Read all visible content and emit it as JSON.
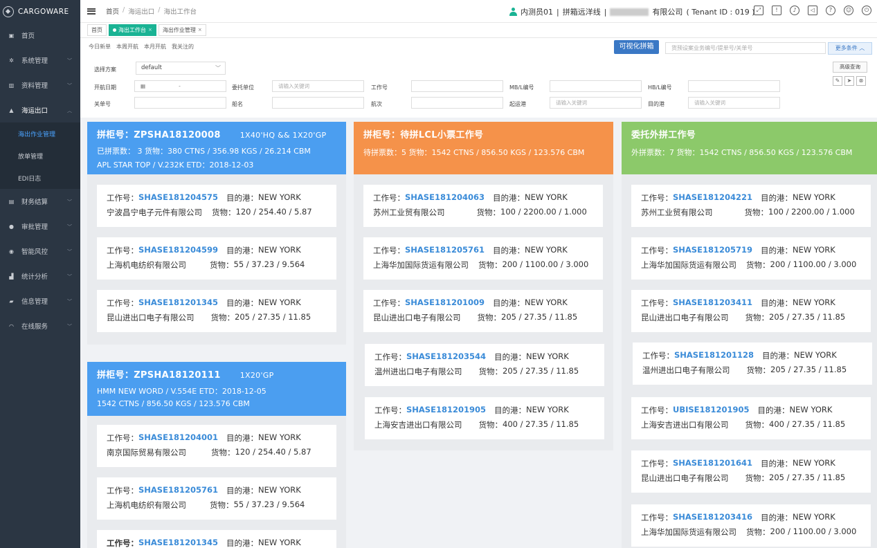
{
  "sidebar": {
    "brand": "CARGOWARE",
    "items": [
      {
        "label": "首页",
        "icon": "dashboard-icon"
      },
      {
        "label": "系统管理",
        "icon": "gear-icon"
      },
      {
        "label": "资料管理",
        "icon": "book-icon"
      },
      {
        "label": "海运出口",
        "icon": "ship-icon"
      },
      {
        "label": "财务结算",
        "icon": "wallet-icon"
      },
      {
        "label": "审批管理",
        "icon": "check-icon"
      },
      {
        "label": "智能风控",
        "icon": "shield-icon"
      },
      {
        "label": "统计分析",
        "icon": "bar-chart-icon"
      },
      {
        "label": "信息管理",
        "icon": "message-icon"
      },
      {
        "label": "在线服务",
        "icon": "wifi-icon"
      }
    ],
    "subitems": [
      "海出作业管理",
      "放单管理",
      "EDI日志"
    ]
  },
  "header": {
    "crumb_home": "首页",
    "crumb_mid": "海运出口",
    "crumb_current": "海出工作台",
    "user": "内测员01",
    "role": "拼箱远洋线",
    "company_suffix": "有限公司",
    "tenant": "( Tenant ID : 019 )"
  },
  "tabs": [
    {
      "label": "首页"
    },
    {
      "label": "海出工作台"
    },
    {
      "label": "海出作业管理"
    }
  ],
  "filters": {
    "quick": [
      "今日新单",
      "本周开航",
      "本月开航",
      "我关注的"
    ],
    "viz_button": "可视化拼箱",
    "search_placeholder": "货预设案业务编号/提单号/关单号",
    "more_button": "更多条件",
    "scheme_label": "选择方案",
    "scheme_value": "default",
    "advanced_button": "高级查询",
    "sail_date": "开航日期",
    "date_sep": "-",
    "consignor": "委托单位",
    "job_no": "工作号",
    "mbl": "MB/L编号",
    "hbl": "HB/L编号",
    "customs_no": "关单号",
    "vessel": "船名",
    "voyage": "航次",
    "pol": "起运港",
    "pod": "目的港",
    "keyword_placeholder": "请输入关键词"
  },
  "labels": {
    "job": "工作号：",
    "dest": "目的港：",
    "cargo": "货物："
  },
  "columns": [
    {
      "color": "#4b9ef0",
      "header": [
        {
          "title": "拼柜号：ZPSHA18120008",
          "container": "1X40'HQ && 1X20'GP",
          "line2": "已拼票数：  3      货物：380 CTNS / 356.98 KGS / 26.214 CBM",
          "line3": "APL STAR TOP / V.232K                    ETD：2018-12-03",
          "cards": [
            {
              "job": "SHASE181204575",
              "dest": "NEW YORK",
              "company": "宁波昌宁电子元件有限公司",
              "cargo": "120 / 254.40 / 5.87"
            },
            {
              "job": "SHASE181204599",
              "dest": "NEW YORK",
              "company": "上海机电纺织有限公司",
              "cargo": "55  / 37.23 / 9.564"
            },
            {
              "job": "SHASE181201345",
              "dest": "NEW YORK",
              "company": "昆山进出口电子有限公司",
              "cargo": "205  / 27.35 / 11.85"
            }
          ]
        },
        {
          "title": "拼柜号：ZPSHA18120111",
          "container": "1X20'GP",
          "line2": "HMM NEW WORD / V.554E           ETD：2018-12-05",
          "line3": "1542 CTNS / 856.50 KGS / 123.576 CBM",
          "cards": [
            {
              "job": "SHASE181204001",
              "dest": "NEW YORK",
              "company": "南京国际贸易有限公司",
              "cargo": "120 / 254.40 / 5.87"
            },
            {
              "job": "SHASE181205761",
              "dest": "NEW YORK",
              "company": "上海机电纺织有限公司",
              "cargo": "55  / 37.23 / 9.564"
            },
            {
              "job": "SHASE181201345",
              "dest": "NEW YORK",
              "company": "",
              "cargo": ""
            }
          ]
        }
      ]
    },
    {
      "color": "#f5924a",
      "header": [
        {
          "title": "拼柜号：待拼LCL小票工作号",
          "container": "",
          "line2": "待拼票数：5      货物：1542 CTNS / 856.50 KGS / 123.576 CBM",
          "line3": "",
          "cards": [
            {
              "job": "SHASE181204063",
              "dest": "NEW YORK",
              "company": "苏州工业贸有限公司",
              "cargo": "100 / 2200.00 / 1.000"
            },
            {
              "job": "SHASE181205761",
              "dest": "NEW YORK",
              "company": "上海华加国际货运有限公司",
              "cargo": "200 / 1100.00 / 3.000"
            },
            {
              "job": "SHASE181201009",
              "dest": "NEW YORK",
              "company": "昆山进出口电子有限公司",
              "cargo": "205  / 27.35 / 11.85"
            },
            {
              "job": "SHASE181203544",
              "dest": "NEW YORK",
              "company": "温州进出口电子有限公司",
              "cargo": "205  / 27.35 / 11.85"
            },
            {
              "job": "SHASE181201905",
              "dest": "NEW YORK",
              "company": "上海安吉进出口有限公司",
              "cargo": "400  / 27.35 / 11.85"
            }
          ]
        }
      ]
    },
    {
      "color": "#8cc96a",
      "header": [
        {
          "title": "委托外拼工作号",
          "container": "",
          "line2": "外拼票数：7      货物：1542 CTNS / 856.50 KGS / 123.576 CBM",
          "line3": "",
          "cards": [
            {
              "job": "SHASE181204221",
              "dest": "NEW YORK",
              "company": "苏州工业贸有限公司",
              "cargo": "100 / 2200.00 / 1.000"
            },
            {
              "job": "SHASE181205719",
              "dest": "NEW YORK",
              "company": "上海华加国际货运有限公司",
              "cargo": "200 / 1100.00 / 3.000"
            },
            {
              "job": "SHASE181203411",
              "dest": "NEW YORK",
              "company": "昆山进出口电子有限公司",
              "cargo": "205  / 27.35 / 11.85"
            },
            {
              "job": "SHASE181201128",
              "dest": "NEW YORK",
              "company": "温州进出口电子有限公司",
              "cargo": "205  / 27.35 / 11.85"
            },
            {
              "job": "UBISE181201905",
              "dest": "NEW YORK",
              "company": "上海安吉进出口有限公司",
              "cargo": "400  / 27.35 / 11.85"
            },
            {
              "job": "SHASE181201641",
              "dest": "NEW YORK",
              "company": "昆山进出口电子有限公司",
              "cargo": "205  / 27.35 / 11.85"
            },
            {
              "job": "SHASE181203416",
              "dest": "NEW YORK",
              "company": "上海华加国际货运有限公司",
              "cargo": "200 / 1100.00 / 3.000"
            }
          ]
        }
      ]
    }
  ]
}
